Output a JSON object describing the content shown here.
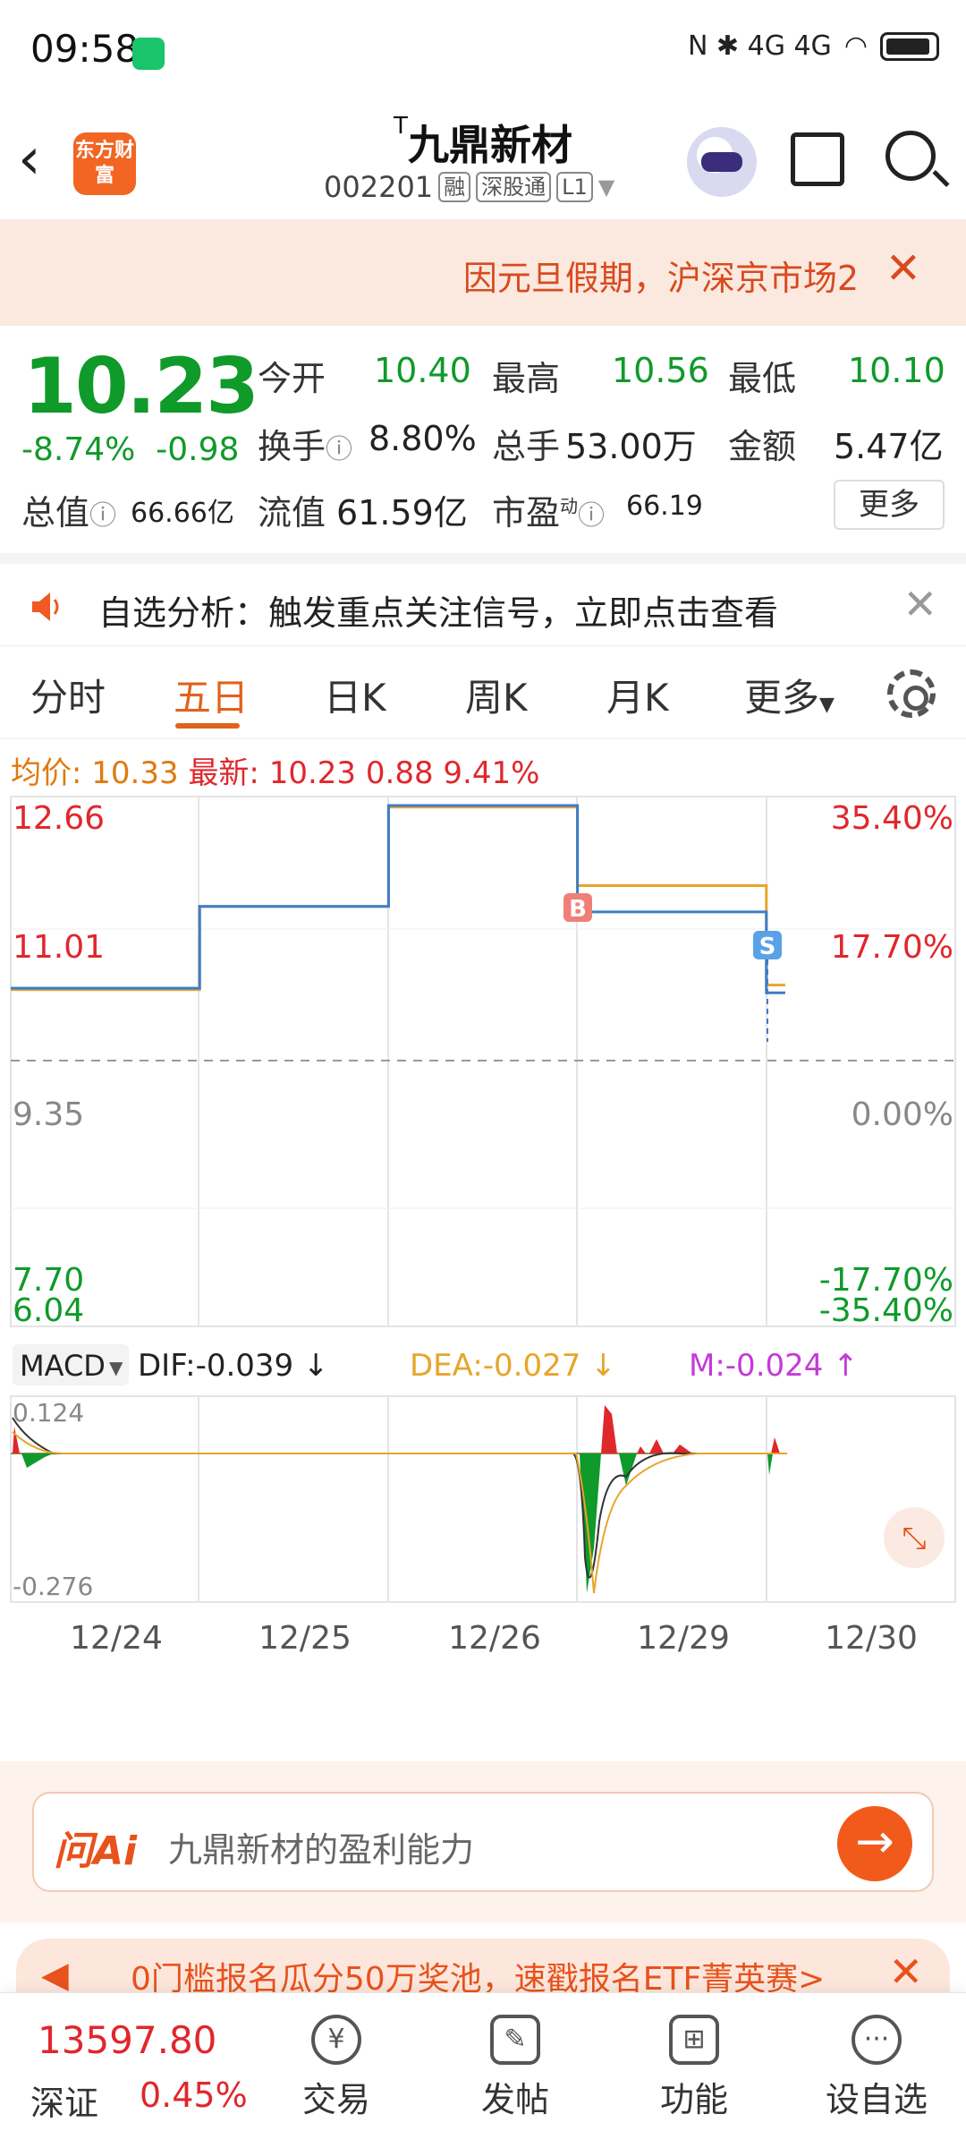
{
  "status": {
    "time": "09:58",
    "icons": "N ✱ 4G 4G"
  },
  "header": {
    "logo": "东方财富",
    "title_prefix": "T",
    "title": "九鼎新材",
    "code": "002201",
    "tags": [
      "融",
      "深股通",
      "L1"
    ]
  },
  "notice": {
    "text": "因元旦假期，沪深京市场2"
  },
  "quote": {
    "price": "10.23",
    "change_pct": "-8.74%",
    "change_abs": "-0.98",
    "open_label": "今开",
    "open": "10.40",
    "high_label": "最高",
    "high": "10.56",
    "low_label": "最低",
    "low": "10.10",
    "turnover_label": "换手",
    "turnover": "8.80%",
    "volume_label": "总手",
    "volume": "53.00万",
    "amount_label": "金额",
    "amount": "5.47亿",
    "mktcap_label": "总值",
    "mktcap": "66.66亿",
    "float_label": "流值",
    "float": "61.59亿",
    "pe_label": "市盈",
    "pe_sup": "动",
    "pe": "66.19",
    "more": "更多"
  },
  "analysis": {
    "text": "自选分析：触发重点关注信号，立即点击查看"
  },
  "tabs": [
    "分时",
    "五日",
    "日K",
    "周K",
    "月K",
    "更多"
  ],
  "active_tab": "五日",
  "infoline": {
    "avg_label": "均价:",
    "avg": "10.33",
    "latest_label": "最新:",
    "latest": "10.23",
    "chg": "0.88",
    "chg_pct": "9.41%"
  },
  "chart": {
    "price_ticks": [
      "12.66",
      "11.01",
      "9.35",
      "7.70",
      "6.04"
    ],
    "pct_ticks": [
      "35.40%",
      "17.70%",
      "0.00%",
      "-17.70%",
      "-35.40%"
    ],
    "markers": [
      "B",
      "S"
    ],
    "macd_label": "MACD",
    "dif": "DIF:-0.039",
    "dea": "DEA:-0.027",
    "m": "M:-0.024",
    "macd_ticks": [
      "0.124",
      "-0.276"
    ],
    "dates": [
      "12/24",
      "12/25",
      "12/26",
      "12/29",
      "12/30"
    ]
  },
  "chart_data": {
    "type": "line",
    "x": [
      "12/24",
      "12/25",
      "12/26",
      "12/29",
      "12/30"
    ],
    "series": [
      {
        "name": "最新",
        "values": [
          10.29,
          11.35,
          12.66,
          11.28,
          10.23
        ]
      },
      {
        "name": "均价",
        "values": [
          10.27,
          11.35,
          12.64,
          11.62,
          10.33
        ]
      }
    ],
    "ylim": [
      6.04,
      12.66
    ],
    "reference": 9.35,
    "colors": {
      "price": "#3d7dc8",
      "avg": "#e7a52b",
      "up": "#e0272c",
      "down": "#0f9a2a"
    }
  },
  "ai": {
    "logo": "问Ai",
    "text": "九鼎新材的盈利能力",
    "go": "→"
  },
  "promo": {
    "text": "0门槛报名瓜分50万奖池，速戳报名ETF菁英赛>"
  },
  "bottom": {
    "index_value": "13597.80",
    "index_name": "深证",
    "index_pct": "0.45%",
    "nav": [
      "交易",
      "发帖",
      "功能",
      "设自选"
    ]
  }
}
